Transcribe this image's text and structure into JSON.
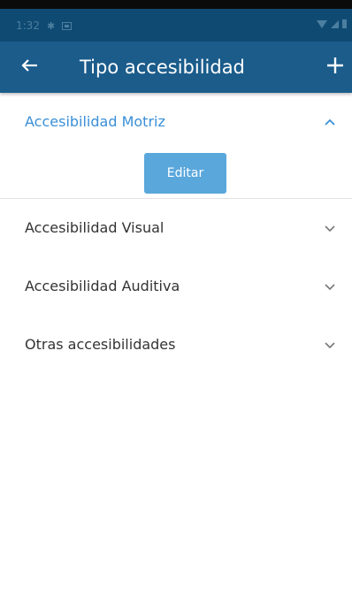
{
  "status_bar": {
    "time": "1:32",
    "icons": [
      "gear-icon",
      "image-icon",
      "wifi-icon",
      "signal-icon",
      "battery-icon"
    ]
  },
  "app_bar": {
    "title": "Tipo accesibilidad",
    "back_icon": "arrow-left-icon",
    "add_icon": "plus-icon",
    "background_color": "#1b5c8b"
  },
  "accordion": {
    "items": [
      {
        "label": "Accesibilidad Motriz",
        "expanded": true,
        "action_label": "Editar"
      },
      {
        "label": "Accesibilidad Visual",
        "expanded": false
      },
      {
        "label": "Accesibilidad Auditiva",
        "expanded": false
      },
      {
        "label": "Otras accesibilidades",
        "expanded": false
      }
    ]
  },
  "colors": {
    "accent": "#3a8fd8",
    "button": "#5aa7dc",
    "status_bar": "#0f4a73"
  }
}
